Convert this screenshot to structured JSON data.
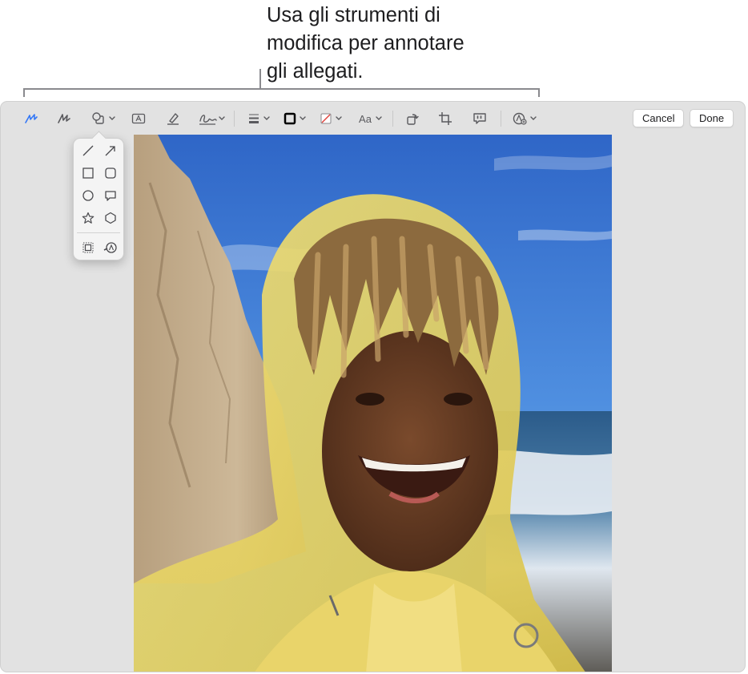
{
  "callout": {
    "lines": [
      "Usa gli strumenti di",
      "modifica per annotare",
      "gli allegati."
    ]
  },
  "toolbar": {
    "tools": [
      "sketch-icon",
      "draw-icon",
      "shapes-icon",
      "text-icon",
      "highlight-icon",
      "sign-icon",
      "shape-style-icon",
      "border-color-icon",
      "fill-color-icon",
      "text-style-icon",
      "rotate-icon",
      "crop-icon",
      "description-icon",
      "markup-more-icon"
    ],
    "text_style_label": "Aa",
    "cancel_label": "Cancel",
    "done_label": "Done"
  },
  "shapes_menu": {
    "items": [
      "line-icon",
      "arrow-icon",
      "rectangle-icon",
      "rounded-rectangle-icon",
      "oval-icon",
      "speech-bubble-icon",
      "star-icon",
      "hexagon-icon",
      "mask-icon",
      "loupe-icon"
    ]
  },
  "colors": {
    "accent": "#3478f6",
    "window_bg": "#e2e2e2",
    "toolbar_icon": "#5a5a5e",
    "border_color": "#000000",
    "fill_slash": "#e0403a"
  },
  "photo": {
    "subject": "selfie-yellow-hood"
  }
}
